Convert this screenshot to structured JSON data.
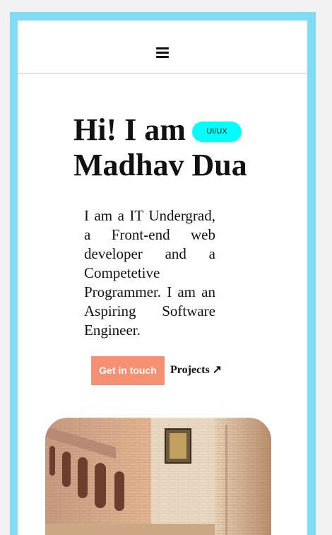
{
  "nav": {
    "menu_icon": "hamburger-menu-icon"
  },
  "hero": {
    "title_line1": "Hi! I am",
    "title_line2": "Madhav Dua",
    "badge": "UI/UX",
    "bio": "I am a IT Undergrad, a Front-end web developer and a Competetive Programmer. I am an Aspiring Software Engineer."
  },
  "actions": {
    "cta_label": "Get in touch",
    "projects_label": "Projects",
    "projects_icon": "arrow-up-right-icon",
    "projects_glyph": "↗"
  },
  "colors": {
    "frame": "#7fdcf7",
    "badge": "#00ffff",
    "cta": "#f69072"
  }
}
